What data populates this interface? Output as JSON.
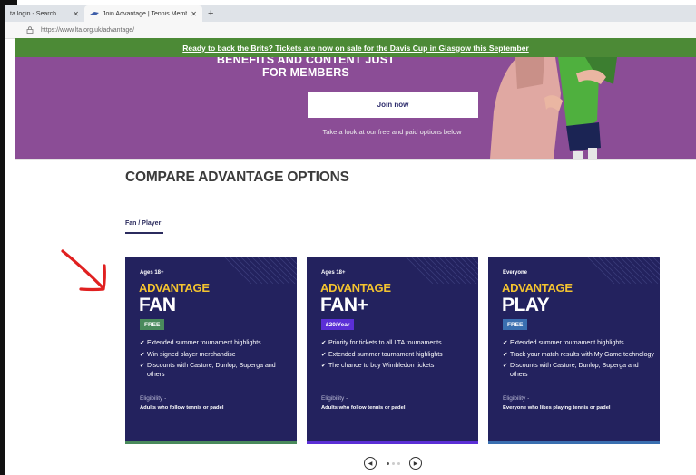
{
  "browser": {
    "tabs": [
      {
        "title": "ta login - Search",
        "close": "✕"
      },
      {
        "title": "Join Advantage | Tennis Membe",
        "close": "✕"
      }
    ],
    "new_tab": "+",
    "url": "https://www.lta.org.uk/advantage/"
  },
  "promo": {
    "text": "Ready to back the Brits? Tickets are now on sale for the Davis Cup in Glasgow this September"
  },
  "hero": {
    "heading_line1": "BENEFITS AND CONTENT JUST",
    "heading_line2": "FOR MEMBERS",
    "join_label": "Join now",
    "subtext": "Take a look at our free and paid options below"
  },
  "section": {
    "title": "COMPARE ADVANTAGE OPTIONS",
    "tab_label": "Fan / Player"
  },
  "cards": [
    {
      "age": "Ages 18+",
      "brand": "ADVANTAGE",
      "name": "FAN",
      "badge": "FREE",
      "badge_color": "#4a8a5c",
      "features": [
        "Extended summer tournament highlights",
        "Win signed player merchandise",
        "Discounts with Castore, Dunlop, Superga and others"
      ],
      "eligibility_label": "Eligibility -",
      "eligibility": "Adults who follow tennis or padel",
      "bar_color": "#4a8a5c"
    },
    {
      "age": "Ages 18+",
      "brand": "ADVANTAGE",
      "name": "FAN+",
      "badge": "£20/Year",
      "badge_color": "#5b2fd6",
      "features": [
        "Priority for tickets to all LTA tournaments",
        "Extended summer tournament highlights",
        "The chance to buy Wimbledon tickets"
      ],
      "eligibility_label": "Eligibility -",
      "eligibility": "Adults who follow tennis or padel",
      "bar_color": "#5b2fd6"
    },
    {
      "age": "Everyone",
      "brand": "ADVANTAGE",
      "name": "PLAY",
      "badge": "FREE",
      "badge_color": "#3a6fb0",
      "features": [
        "Extended summer tournament highlights",
        "Track your match results with My Game technology",
        "Discounts with Castore, Dunlop, Superga and others"
      ],
      "eligibility_label": "Eligibility -",
      "eligibility": "Everyone who likes playing tennis or padel",
      "bar_color": "#3a6fb0"
    }
  ],
  "pager": {
    "prev": "◀",
    "next": "▶",
    "active_index": 0,
    "count": 3
  },
  "icons": {
    "check": "✔"
  }
}
